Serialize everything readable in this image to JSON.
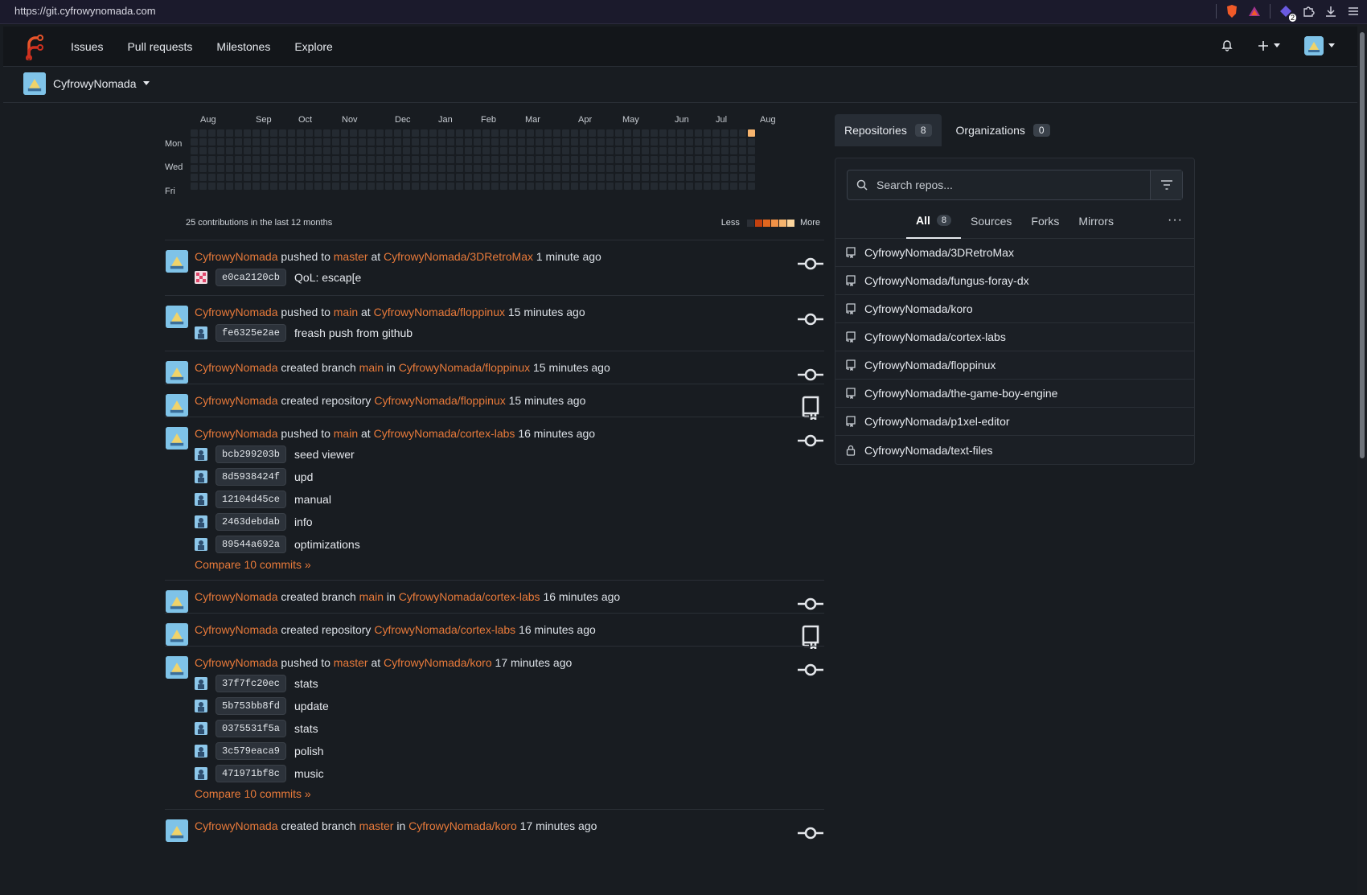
{
  "browser": {
    "url": "https://git.cyfrowynomada.com",
    "ext_count": "2"
  },
  "nav": {
    "links": [
      "Issues",
      "Pull requests",
      "Milestones",
      "Explore"
    ]
  },
  "context": {
    "user": "CyfrowyNomada"
  },
  "heatmap": {
    "months": [
      "Aug",
      "Sep",
      "Oct",
      "Nov",
      "Dec",
      "Jan",
      "Feb",
      "Mar",
      "Apr",
      "May",
      "Jun",
      "Jul",
      "Aug"
    ],
    "days": [
      "Mon",
      "Wed",
      "Fri"
    ],
    "summary": "25 contributions in the last 12 months",
    "legend_less": "Less",
    "legend_more": "More",
    "legend_colors": [
      "#2b2f36",
      "#c4410f",
      "#e2671f",
      "#f29247",
      "#f6b46e",
      "#fbd49c"
    ],
    "active_color": "#f6b46e"
  },
  "feed": [
    {
      "user": "CyfrowyNomada",
      "action": "pushed to",
      "ref": "master",
      "prep": "at",
      "repo": "CyfrowyNomada/3DRetroMax",
      "time": "1 minute ago",
      "icon": "commit-icon",
      "commits": [
        {
          "sha": "e0ca2120cb",
          "msg": "QoL: escap[e"
        }
      ],
      "compare": ""
    },
    {
      "user": "CyfrowyNomada",
      "action": "pushed to",
      "ref": "main",
      "prep": "at",
      "repo": "CyfrowyNomada/floppinux",
      "time": "15 minutes ago",
      "icon": "commit-icon",
      "commits": [
        {
          "sha": "fe6325e2ae",
          "msg": "freash push from github"
        }
      ],
      "compare": ""
    },
    {
      "user": "CyfrowyNomada",
      "action": "created branch",
      "ref": "main",
      "prep": "in",
      "repo": "CyfrowyNomada/floppinux",
      "time": "15 minutes ago",
      "icon": "commit-icon",
      "commits": [],
      "compare": ""
    },
    {
      "user": "CyfrowyNomada",
      "action": "created repository",
      "ref": "",
      "prep": "",
      "repo": "CyfrowyNomada/floppinux",
      "time": "15 minutes ago",
      "icon": "repo-icon",
      "commits": [],
      "compare": ""
    },
    {
      "user": "CyfrowyNomada",
      "action": "pushed to",
      "ref": "main",
      "prep": "at",
      "repo": "CyfrowyNomada/cortex-labs",
      "time": "16 minutes ago",
      "icon": "commit-icon",
      "commits": [
        {
          "sha": "bcb299203b",
          "msg": "seed viewer"
        },
        {
          "sha": "8d5938424f",
          "msg": "upd"
        },
        {
          "sha": "12104d45ce",
          "msg": "manual"
        },
        {
          "sha": "2463debdab",
          "msg": "info"
        },
        {
          "sha": "89544a692a",
          "msg": "optimizations"
        }
      ],
      "compare": "Compare 10 commits »"
    },
    {
      "user": "CyfrowyNomada",
      "action": "created branch",
      "ref": "main",
      "prep": "in",
      "repo": "CyfrowyNomada/cortex-labs",
      "time": "16 minutes ago",
      "icon": "commit-icon",
      "commits": [],
      "compare": ""
    },
    {
      "user": "CyfrowyNomada",
      "action": "created repository",
      "ref": "",
      "prep": "",
      "repo": "CyfrowyNomada/cortex-labs",
      "time": "16 minutes ago",
      "icon": "repo-icon",
      "commits": [],
      "compare": ""
    },
    {
      "user": "CyfrowyNomada",
      "action": "pushed to",
      "ref": "master",
      "prep": "at",
      "repo": "CyfrowyNomada/koro",
      "time": "17 minutes ago",
      "icon": "commit-icon",
      "commits": [
        {
          "sha": "37f7fc20ec",
          "msg": "stats"
        },
        {
          "sha": "5b753bb8fd",
          "msg": "update"
        },
        {
          "sha": "0375531f5a",
          "msg": "stats"
        },
        {
          "sha": "3c579eaca9",
          "msg": "polish"
        },
        {
          "sha": "471971bf8c",
          "msg": "music"
        }
      ],
      "compare": "Compare 10 commits »"
    },
    {
      "user": "CyfrowyNomada",
      "action": "created branch",
      "ref": "master",
      "prep": "in",
      "repo": "CyfrowyNomada/koro",
      "time": "17 minutes ago",
      "icon": "commit-icon",
      "commits": [],
      "compare": ""
    }
  ],
  "sidebar": {
    "tabs": [
      {
        "label": "Repositories",
        "count": "8"
      },
      {
        "label": "Organizations",
        "count": "0"
      }
    ],
    "search_placeholder": "Search repos...",
    "filters": [
      {
        "label": "All",
        "count": "8"
      },
      {
        "label": "Sources",
        "count": ""
      },
      {
        "label": "Forks",
        "count": ""
      },
      {
        "label": "Mirrors",
        "count": ""
      }
    ],
    "more": "···",
    "repos": [
      {
        "name": "CyfrowyNomada/3DRetroMax",
        "icon": "repo-icon"
      },
      {
        "name": "CyfrowyNomada/fungus-foray-dx",
        "icon": "repo-icon"
      },
      {
        "name": "CyfrowyNomada/koro",
        "icon": "repo-icon"
      },
      {
        "name": "CyfrowyNomada/cortex-labs",
        "icon": "repo-icon"
      },
      {
        "name": "CyfrowyNomada/floppinux",
        "icon": "repo-icon"
      },
      {
        "name": "CyfrowyNomada/the-game-boy-engine",
        "icon": "repo-icon"
      },
      {
        "name": "CyfrowyNomada/p1xel-editor",
        "icon": "repo-icon"
      },
      {
        "name": "CyfrowyNomada/text-files",
        "icon": "lock-icon"
      }
    ]
  }
}
